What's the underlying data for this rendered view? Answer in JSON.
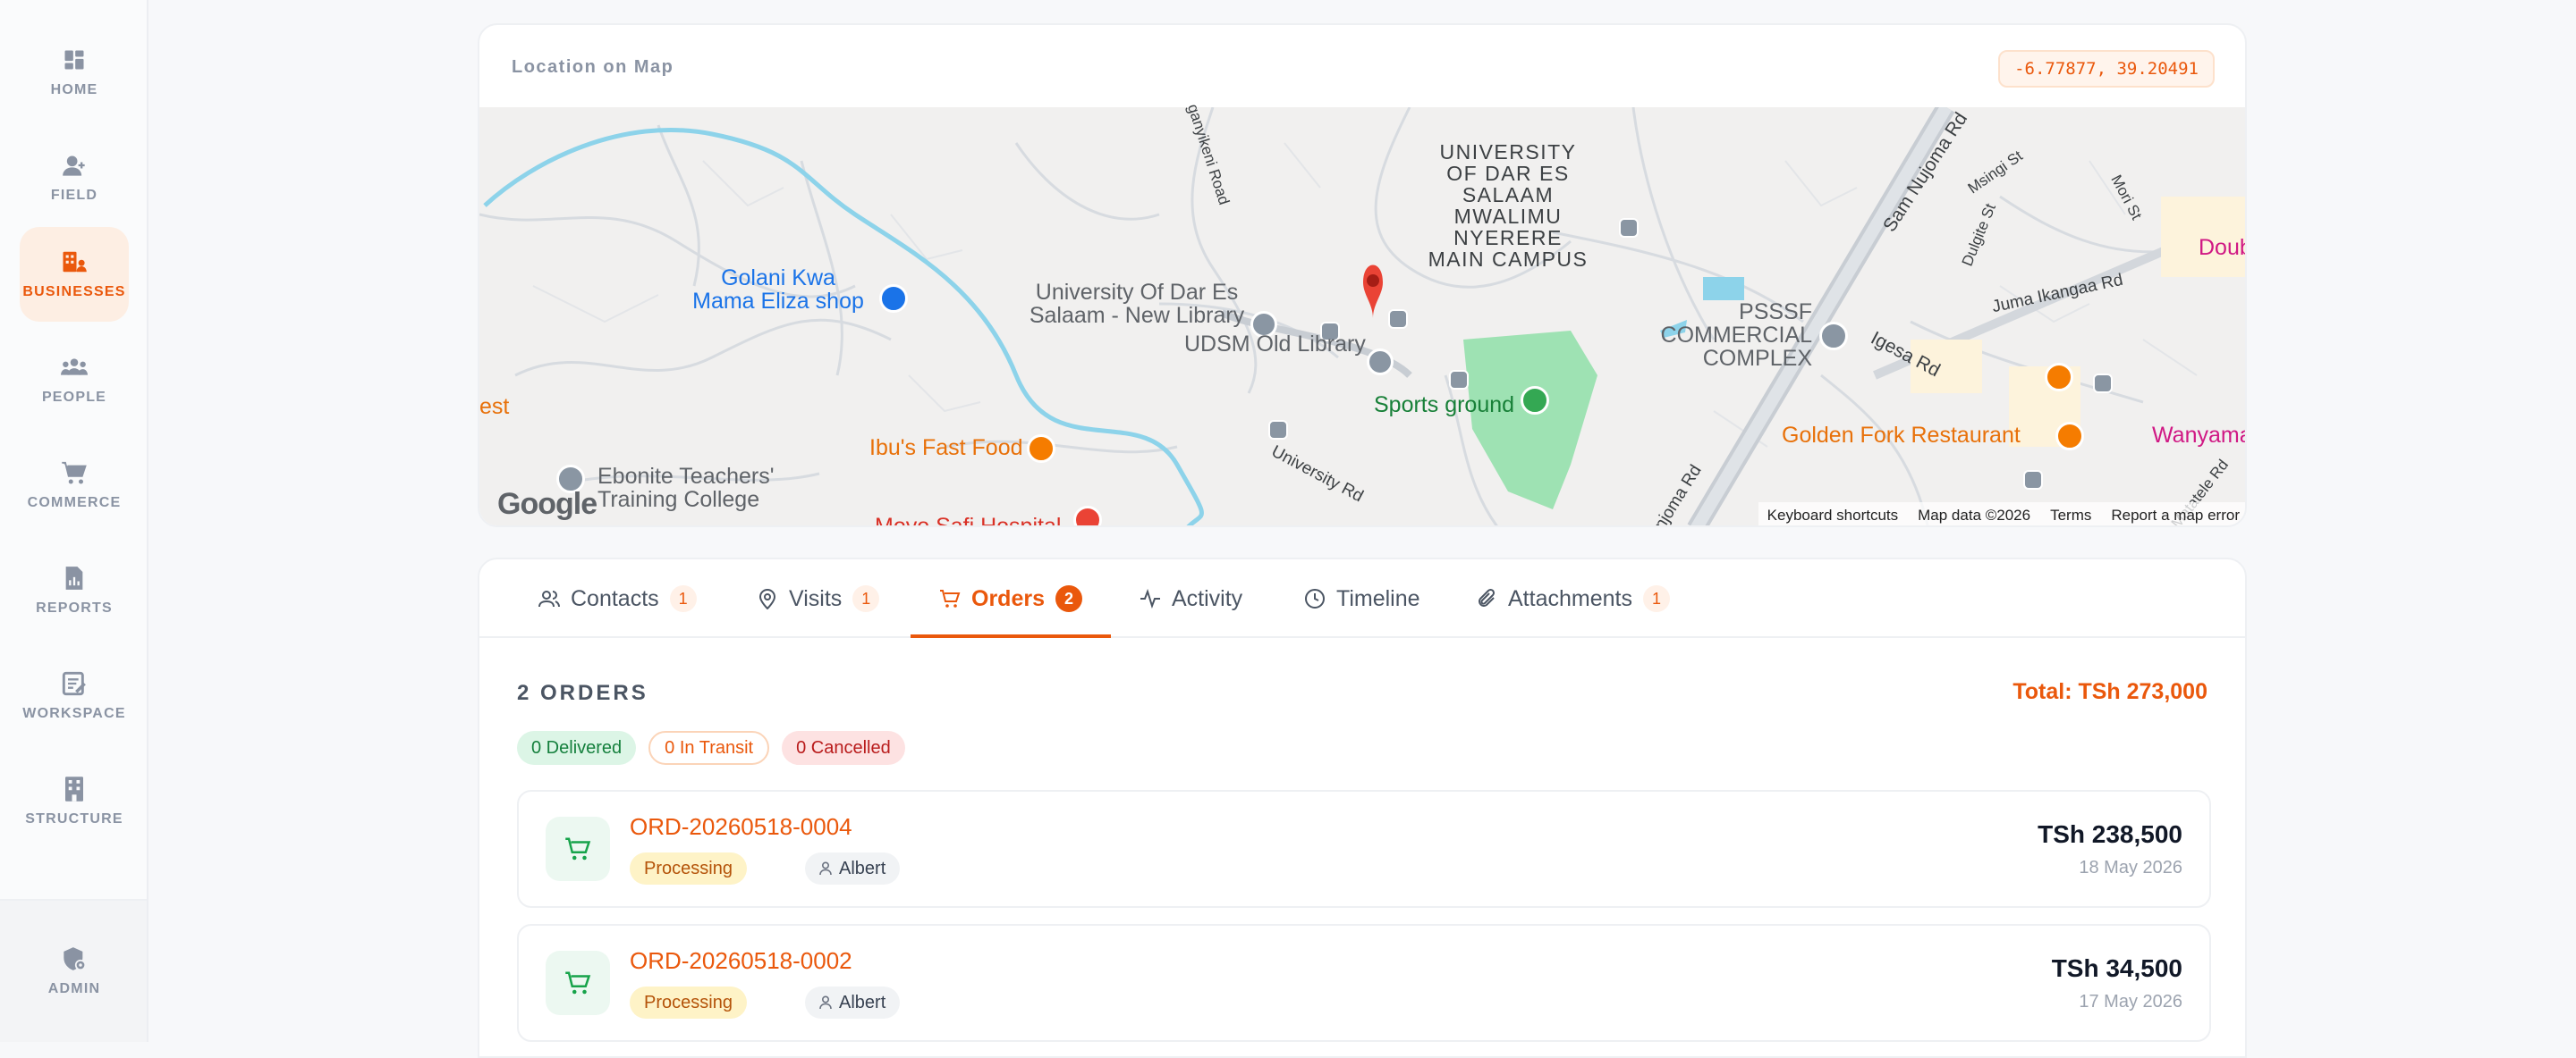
{
  "sidebar": {
    "items": [
      {
        "label": "HOME",
        "icon": "home-icon"
      },
      {
        "label": "FIELD",
        "icon": "field-user-icon"
      },
      {
        "label": "BUSINESSES",
        "icon": "businesses-icon",
        "active": true
      },
      {
        "label": "PEOPLE",
        "icon": "people-icon"
      },
      {
        "label": "COMMERCE",
        "icon": "cart-icon"
      },
      {
        "label": "REPORTS",
        "icon": "reports-icon"
      },
      {
        "label": "WORKSPACE",
        "icon": "workspace-icon"
      },
      {
        "label": "STRUCTURE",
        "icon": "structure-icon"
      }
    ],
    "admin": {
      "label": "ADMIN",
      "icon": "admin-shield-icon"
    }
  },
  "map": {
    "title": "Location on Map",
    "coordinates": "-6.77877, 39.20491",
    "labels": {
      "campus": "UNIVERSITY OF DAR ES SALAAM MWALIMU NYERERE MAIN CAMPUS",
      "golani": "Golani Kwa Mama Eliza shop",
      "new_library": "University Of Dar Es Salaam - New Library",
      "old_library": "UDSM Old Library",
      "sports": "Sports ground",
      "psssf": "PSSSF COMMERCIAL COMPLEX",
      "ibus": "Ibu's Fast Food",
      "ebonite": "Ebonite Teachers' Training College",
      "moyo": "Moyo Safi Hospital",
      "golden": "Golden Fork Restaurant",
      "wanyama": "Wanyama",
      "doub": "Doub",
      "est": "est",
      "sam_nujoma": "Sam Nujoma Rd",
      "igesa": "Igesa Rd",
      "university_rd": "University Rd",
      "juma": "Juma Ikangaa Rd",
      "ganyikeni": "ganyikeni Road",
      "msingi": "Msingi St",
      "mori": "Mori St",
      "dulgite": "Dulgite St",
      "matatele": "Matatele Rd",
      "nujoma_rd": "njoma Rd"
    },
    "footer": {
      "shortcuts": "Keyboard shortcuts",
      "data": "Map data ©2026",
      "terms": "Terms",
      "report": "Report a map error"
    },
    "logo": "Google"
  },
  "tabs": [
    {
      "label": "Contacts",
      "count": "1",
      "icon": "contacts-icon"
    },
    {
      "label": "Visits",
      "count": "1",
      "icon": "location-pin-icon"
    },
    {
      "label": "Orders",
      "count": "2",
      "icon": "cart-icon",
      "active": true
    },
    {
      "label": "Activity",
      "icon": "activity-icon"
    },
    {
      "label": "Timeline",
      "icon": "clock-icon"
    },
    {
      "label": "Attachments",
      "count": "1",
      "icon": "paperclip-icon"
    }
  ],
  "orders": {
    "heading": "2 ORDERS",
    "total": "Total: TSh 273,000",
    "pills": {
      "delivered": "0 Delivered",
      "transit": "0 In Transit",
      "cancelled": "0 Cancelled"
    },
    "rows": [
      {
        "id": "ORD-20260518-0004",
        "status": "Processing",
        "user": "Albert",
        "amount": "TSh 238,500",
        "date": "18 May 2026"
      },
      {
        "id": "ORD-20260518-0002",
        "status": "Processing",
        "user": "Albert",
        "amount": "TSh 34,500",
        "date": "17 May 2026"
      }
    ]
  },
  "colors": {
    "accent": "#ea580c",
    "active_bg": "#fdeee3",
    "success": "#15803d",
    "danger": "#b91c1c"
  }
}
